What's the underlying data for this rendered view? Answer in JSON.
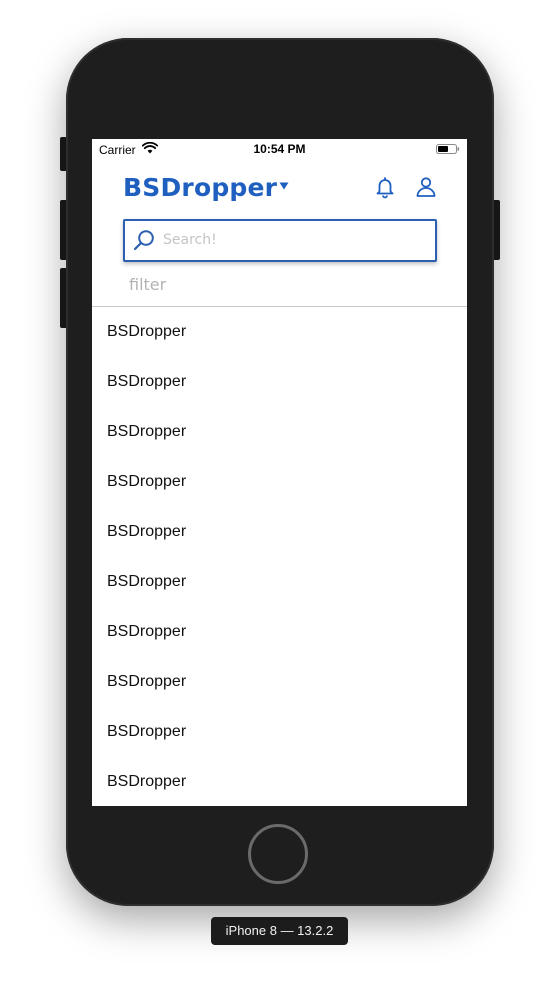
{
  "status_bar": {
    "carrier": "Carrier",
    "time": "10:54 PM"
  },
  "header": {
    "title": "BSDropper",
    "accent_color": "#1f5fbf",
    "icons": [
      "chevron-down-icon",
      "bell-icon",
      "user-icon"
    ]
  },
  "search": {
    "placeholder": "Search!",
    "value": "",
    "border_color": "#2b5fb0"
  },
  "filter": {
    "label": "filter"
  },
  "list": {
    "items": [
      "BSDropper",
      "BSDropper",
      "BSDropper",
      "BSDropper",
      "BSDropper",
      "BSDropper",
      "BSDropper",
      "BSDropper",
      "BSDropper",
      "BSDropper"
    ]
  },
  "simulator": {
    "device_label": "iPhone 8 — 13.2.2"
  }
}
